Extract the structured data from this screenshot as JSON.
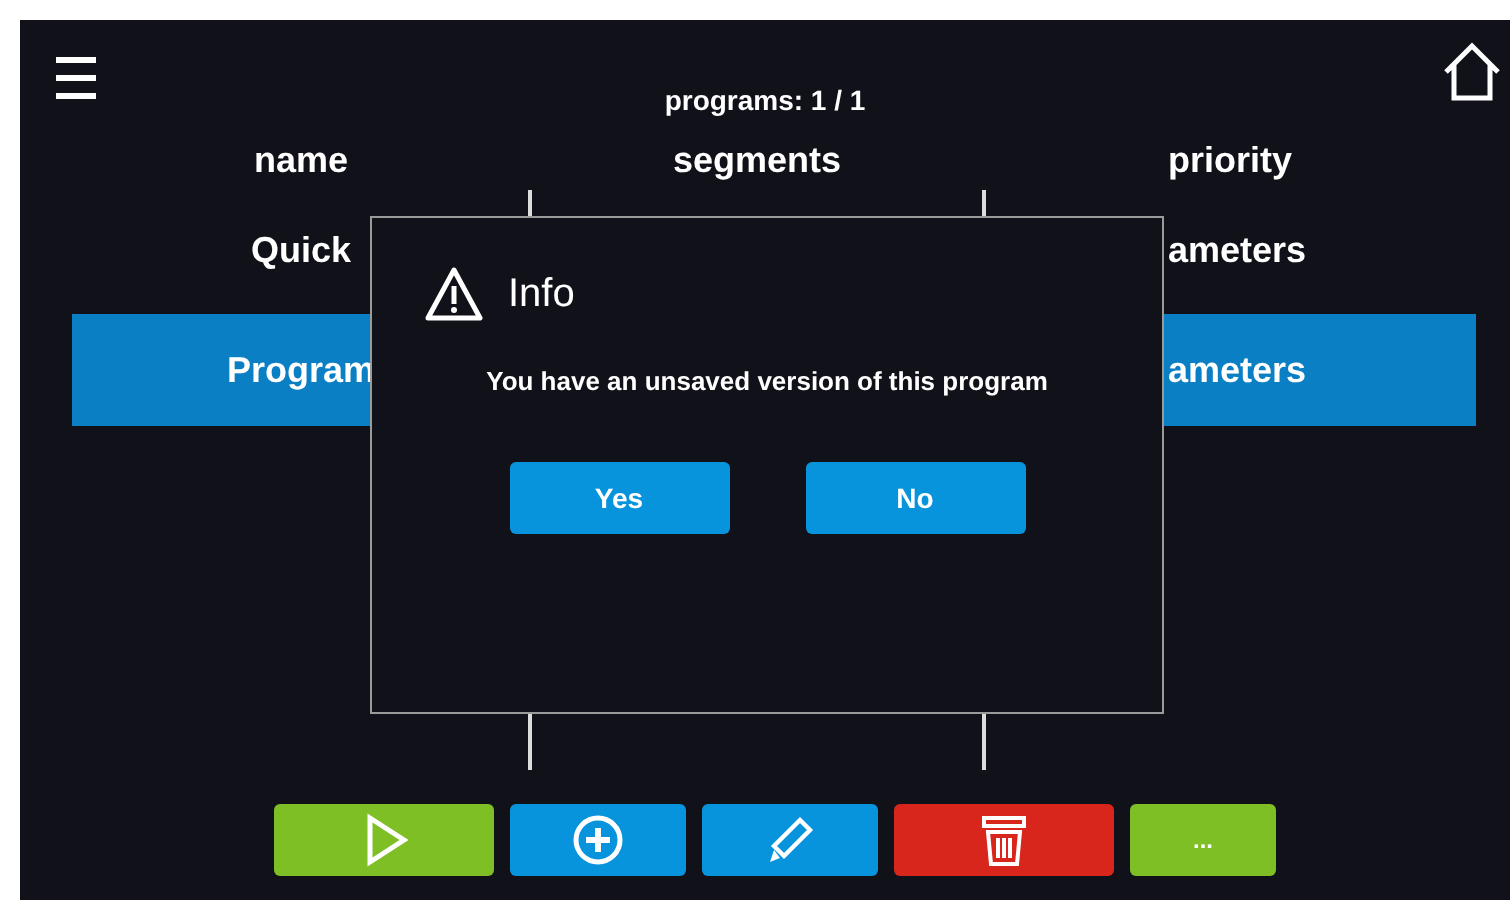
{
  "header": {
    "title": "programs: 1 / 1"
  },
  "table": {
    "columns": [
      "name",
      "segments",
      "priority"
    ],
    "rows": [
      {
        "name": "Quick",
        "priority": "ameters",
        "selected": false
      },
      {
        "name": "Program",
        "priority": "ameters",
        "selected": true
      }
    ]
  },
  "dialog": {
    "title": "Info",
    "message": "You have an unsaved version of this program",
    "buttons": [
      "Yes",
      "No"
    ]
  },
  "toolbar": [
    {
      "kind": "play"
    },
    {
      "kind": "add"
    },
    {
      "kind": "edit"
    },
    {
      "kind": "delete"
    },
    {
      "kind": "more",
      "label": "..."
    }
  ]
}
